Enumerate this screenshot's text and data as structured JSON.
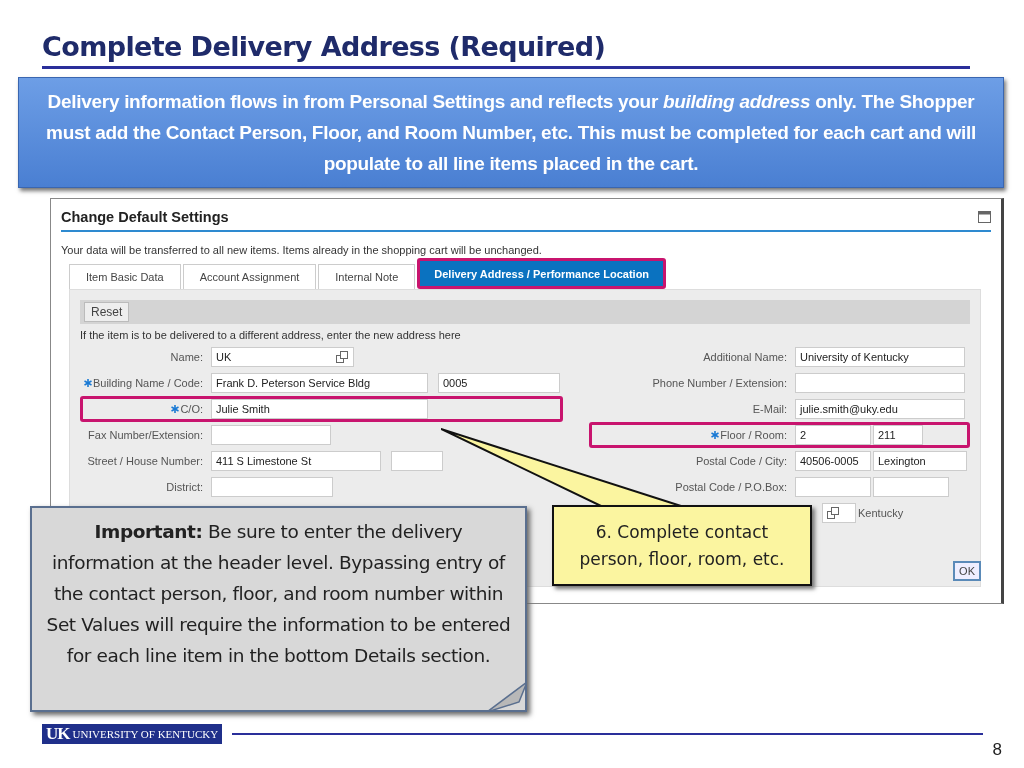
{
  "slide": {
    "title": "Complete Delivery Address (Required)",
    "banner": "Delivery information flows in from Personal Settings and reflects your *building address* only. The Shopper must add the Contact Person, Floor, and Room Number, etc. This must be completed for each cart and will populate to all line items placed in the cart.",
    "logo": {
      "mark": "UK",
      "name": "UNIVERSITY OF KENTUCKY"
    },
    "page_number": "8"
  },
  "dialog": {
    "title": "Change Default Settings",
    "note": "Your data will be transferred to all new items. Items already in the shopping cart will be unchanged.",
    "tabs": [
      {
        "label": "Item Basic Data",
        "selected": false,
        "highlighted": false
      },
      {
        "label": "Account Assignment",
        "selected": false,
        "highlighted": false
      },
      {
        "label": "Internal Note",
        "selected": false,
        "highlighted": false
      },
      {
        "label": "Delivery Address / Performance Location",
        "selected": true,
        "highlighted": true
      }
    ],
    "toolbar": [
      "Reset"
    ],
    "instruction": "If the item is to be delivered to a different address, enter the new address here",
    "left_fields": [
      {
        "label": "Name:",
        "required": false,
        "highlighted": false,
        "inputs": [
          {
            "value": "UK",
            "value_help": true
          }
        ]
      },
      {
        "label": "Building Name / Code:",
        "required": true,
        "highlighted": false,
        "inputs": [
          {
            "value": "Frank D. Peterson Service Bldg",
            "value_help": false
          },
          {
            "value": "0005",
            "value_help": false
          }
        ]
      },
      {
        "label": "C/O:",
        "required": true,
        "highlighted": true,
        "inputs": [
          {
            "value": "Julie Smith",
            "value_help": false
          }
        ]
      },
      {
        "label": "Fax Number/Extension:",
        "required": false,
        "highlighted": false,
        "inputs": [
          {
            "value_help": false
          }
        ]
      },
      {
        "label": "Street / House Number:",
        "required": false,
        "highlighted": false,
        "inputs": [
          {
            "value": "411 S Limestone St",
            "value_help": false
          },
          {
            "value_help": false
          }
        ]
      },
      {
        "label": "District:",
        "required": false,
        "highlighted": false,
        "inputs": [
          {
            "value_help": false
          }
        ]
      }
    ],
    "right_fields": [
      {
        "label": "Additional Name:",
        "required": false,
        "highlighted": false,
        "inputs": [
          {
            "value": "University of Kentucky",
            "value_help": false
          }
        ]
      },
      {
        "label": "Phone Number / Extension:",
        "required": false,
        "highlighted": false,
        "inputs": [
          {
            "value_help": false
          }
        ]
      },
      {
        "label": "E-Mail:",
        "required": false,
        "highlighted": false,
        "inputs": [
          {
            "value": "julie.smith@uky.edu",
            "value_help": false
          }
        ]
      },
      {
        "label": "Floor / Room:",
        "required": true,
        "highlighted": true,
        "inputs": [
          {
            "value": "2",
            "value_help": false
          },
          {
            "value": "211",
            "value_help": false
          }
        ]
      },
      {
        "label": "Postal Code / City:",
        "required": false,
        "highlighted": false,
        "inputs": [
          {
            "value": "40506-0005",
            "value_help": false
          },
          {
            "value": "Lexington",
            "value_help": false
          }
        ]
      },
      {
        "label": "Postal Code / P.O.Box:",
        "required": false,
        "highlighted": false,
        "inputs": [
          {
            "value_help": false
          },
          {
            "value_help": false
          }
        ]
      },
      {
        "required": false,
        "highlighted": false,
        "inputs": [
          {
            "value_help": true
          }
        ],
        "description": "Kentucky"
      }
    ],
    "buttons": [
      "OK"
    ]
  },
  "callouts": [
    {
      "kind": "note",
      "text": "**Important:** Be sure to enter the delivery information at the header level. Bypassing entry of the contact person, floor, and room number within Set Values will require the information to be entered for each line item in the bottom Details section."
    },
    {
      "kind": "pointer",
      "text": "6. Complete contact person, floor, room, etc."
    }
  ]
}
